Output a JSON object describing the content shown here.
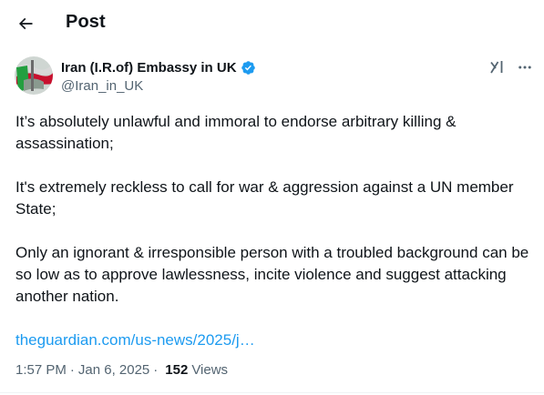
{
  "header": {
    "title": "Post"
  },
  "author": {
    "name": "Iran (I.R.of) Embassy in UK",
    "handle": "@Iran_in_UK",
    "verified_color": "#1d9bf0"
  },
  "post": {
    "paragraphs": [
      "It’s absolutely unlawful and immoral to endorse arbitrary killing & assassination;",
      "It's extremely reckless to call for war & aggression against a UN member State;",
      "Only an ignorant & irresponsible person with a troubled background can be so low as to approve lawlessness, incite violence and suggest attacking another nation."
    ],
    "link_text": "theguardian.com/us-news/2025/j…"
  },
  "meta": {
    "time": "1:57 PM",
    "separator": "·",
    "date": "Jan 6, 2025",
    "views_count": "152",
    "views_label": "Views"
  },
  "icons": {
    "back": "arrow-left-icon",
    "verified": "verified-badge-icon",
    "grok": "grok-icon",
    "more": "more-horizontal-icon"
  },
  "colors": {
    "text": "#0f1419",
    "secondary": "#536471",
    "link": "#1d9bf0"
  }
}
